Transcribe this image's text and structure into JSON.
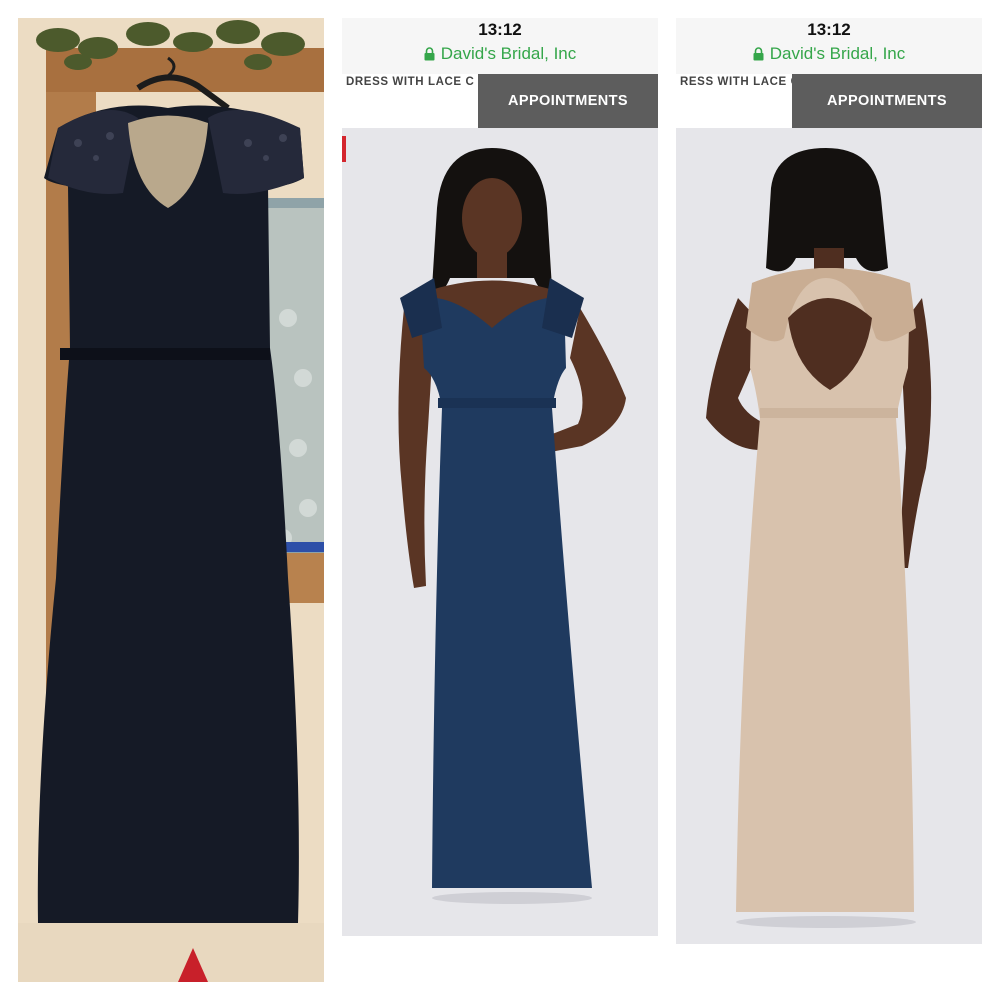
{
  "screenshots": [
    {
      "status_time": "13:12",
      "site_name": "David's Bridal, Inc",
      "product_title_fragment": "DRESS WITH LACE C",
      "appointments_label": "APPOINTMENTS",
      "dress_color": "#1f3a5f"
    },
    {
      "status_time": "13:12",
      "site_name": "David's Bridal, Inc",
      "product_title_fragment": "RESS WITH LACE C",
      "appointments_label": "APPOINTMENTS",
      "dress_color": "#d8c2ad"
    }
  ],
  "photo": {
    "dress_color": "#151a26",
    "wall_color": "#ecdcc3",
    "frame_color": "#b27c4a"
  },
  "colors": {
    "secure_green": "#35a64a",
    "button_gray": "#5d5d5d",
    "sale_red": "#d4262e"
  }
}
